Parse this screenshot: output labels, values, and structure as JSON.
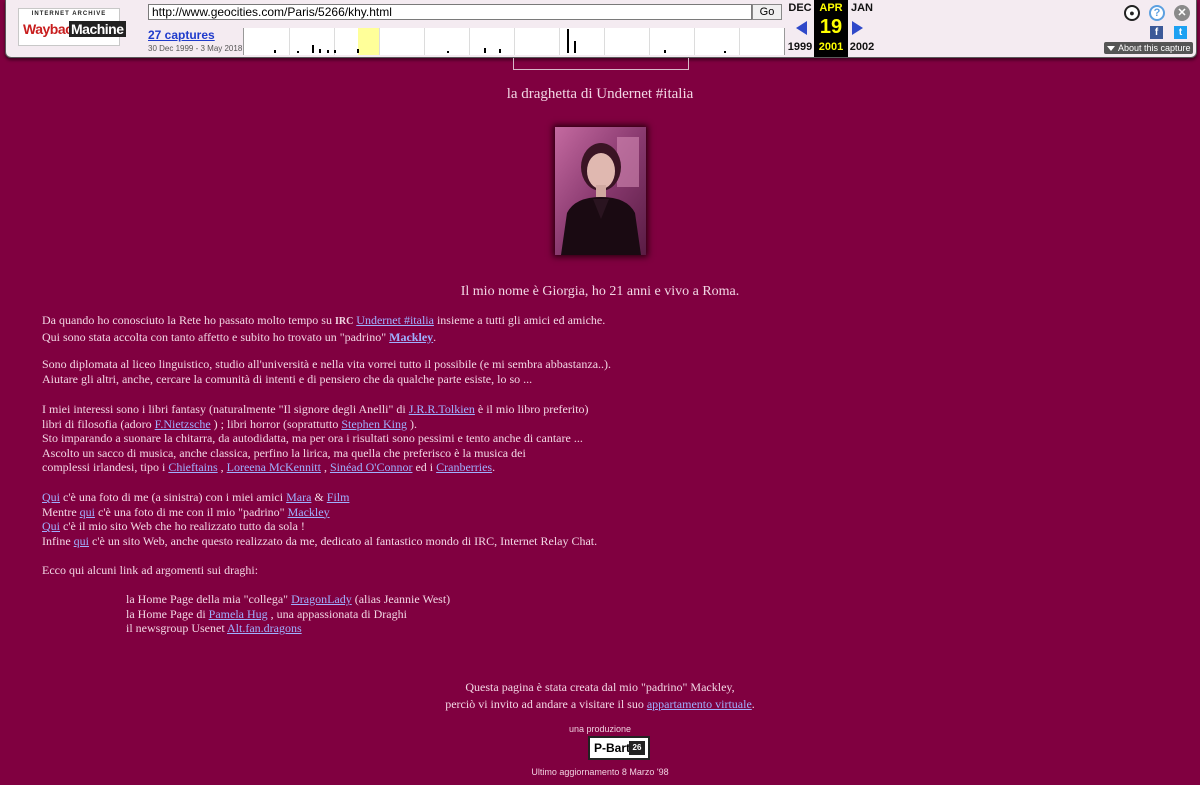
{
  "wayback": {
    "logo_top": "INTERNET ARCHIVE",
    "logo_wayback": "Wayback",
    "logo_machine": "Machine",
    "url": "http://www.geocities.com/Paris/5266/khy.html",
    "go_label": "Go",
    "captures_label": "27 captures",
    "date_range": "30 Dec 1999 - 3 May 2018",
    "prev_month": "DEC",
    "prev_year": "1999",
    "current_month": "APR",
    "current_day": "19",
    "current_year": "2001",
    "next_month": "JAN",
    "next_year": "2002",
    "about_label": "About this capture",
    "sparkline": [
      0,
      0,
      0,
      0,
      2,
      0,
      0,
      1,
      0,
      6,
      3,
      2,
      2,
      0,
      0,
      3,
      0,
      0,
      0,
      0,
      0,
      0,
      0,
      0,
      0,
      0,
      0,
      1,
      0,
      0,
      0,
      0,
      4,
      0,
      3,
      0,
      0,
      0,
      0,
      0,
      0,
      0,
      0,
      18,
      9,
      0,
      0,
      0,
      0,
      0,
      0,
      0,
      0,
      0,
      0,
      0,
      2,
      0,
      0,
      0,
      0,
      0,
      0,
      0,
      1,
      0,
      0,
      0,
      0,
      0,
      0,
      0
    ]
  },
  "page": {
    "title": "la draghetta di Undernet #italia",
    "intro": "Il mio nome è Giorgia, ho 21 anni e vivo a Roma.",
    "p1": {
      "t1": "Da quando ho conosciuto la Rete ho passato molto tempo su ",
      "irc": "IRC",
      "link1": "Undernet #italia",
      "t2": " insieme a tutti gli amici ed amiche.",
      "t3": "Qui sono stata accolta con tanto affetto e subito ho trovato un \"padrino\" ",
      "link2": "Mackley",
      "t4": "."
    },
    "p2": {
      "l1": "Sono diplomata al liceo linguistico, studio all'università e nella vita vorrei tutto il possibile (e mi sembra abbastanza..).",
      "l2": "Aiutare gli altri, anche, cercare la comunità di intenti e di pensiero che da qualche parte esiste, lo so ..."
    },
    "p3": {
      "t1": "I miei interessi sono i libri fantasy (naturalmente \"Il signore degli Anelli\" di ",
      "link_tolkien": "J.R.R.Tolkien",
      "t2": " è il mio libro preferito)",
      "t3": "libri di filosofia (adoro ",
      "link_nietzsche": "F.Nietzsche",
      "t4": " ) ; libri horror (soprattutto ",
      "link_king": "Stephen King",
      "t5": " ).",
      "l3": "Sto imparando a suonare la chitarra, da autodidatta, ma per ora i risultati sono pessimi e tento anche di cantare ...",
      "l4": "Ascolto un sacco di musica, anche classica, perfino la lirica, ma quella che preferisco è la musica dei",
      "t6": "complessi irlandesi, tipo i ",
      "link_chieftains": "Chieftains",
      "sep1": " , ",
      "link_mckennitt": "Loreena McKennitt",
      "sep2": " , ",
      "link_oconnor": "Sinéad O'Connor",
      "t7": " ed i ",
      "link_cranberries": "Cranberries",
      "t8": "."
    },
    "p4": {
      "qui1": "Qui",
      "t1": " c'è una foto di me (a sinistra) con i miei amici ",
      "link_mara": "Mara",
      "amp": " & ",
      "link_film": "Film",
      "t2": "Mentre ",
      "qui2": "qui",
      "t3": " c'è una foto di me con il mio \"padrino\" ",
      "link_mackley": "Mackley",
      "qui3": "Qui",
      "t4": " c'è il mio sito Web che ho realizzato tutto da sola !",
      "t5": "Infine ",
      "qui4": "qui",
      "t6": " c'è un sito Web, anche questo realizzato da me, dedicato al fantastico mondo di IRC, Internet Relay Chat."
    },
    "p5": "Ecco qui alcuni link ad argomenti sui draghi:",
    "dragons": {
      "t1": "la Home Page della mia \"collega\" ",
      "link_dragonlady": "DragonLady",
      "t2": " (alias Jeannie West)",
      "t3": "la Home Page di ",
      "link_pamela": "Pamela Hug",
      "t4": " , una appassionata di Draghi",
      "t5": "il newsgroup Usenet ",
      "link_alt": "Alt.fan.dragons"
    },
    "footer": {
      "l1": "Questa pagina è stata creata dal mio \"padrino\" Mackley,",
      "l2a": "perciò vi invito ad andare a visitare il suo ",
      "link_app": "appartamento virtuale",
      "l2b": ".",
      "production": "una produzione",
      "pbart": "P-Bart",
      "pbart_badge": "26",
      "updated": "Ultimo aggiornamento 8 Marzo '98"
    }
  },
  "colors": {
    "background": "#800040",
    "text": "#f2d6e4",
    "link": "#9fb0ff"
  }
}
